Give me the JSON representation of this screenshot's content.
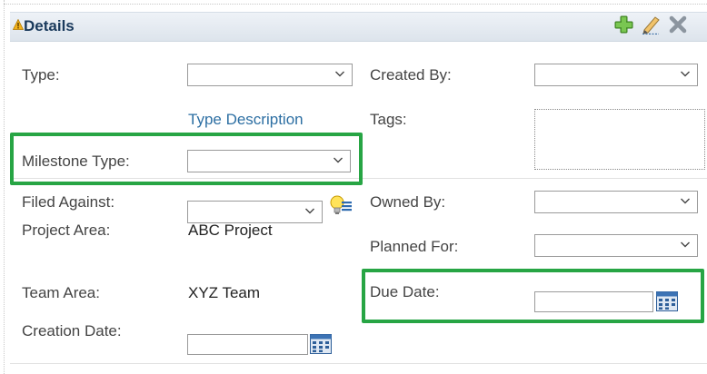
{
  "panel": {
    "title": "Details",
    "actions": {
      "add": "plus-icon",
      "edit": "pencil-icon",
      "close": "x-icon"
    }
  },
  "left_fields": {
    "type_label": "Type:",
    "type_description_link": "Type Description",
    "milestone_type_label": "Milestone Type:",
    "filed_against_label": "Filed Against:",
    "project_area_label": "Project Area:",
    "project_area_value": "ABC Project",
    "team_area_label": "Team Area:",
    "team_area_value": "XYZ Team",
    "creation_date_label": "Creation Date:"
  },
  "right_fields": {
    "created_by_label": "Created By:",
    "tags_label": "Tags:",
    "owned_by_label": "Owned By:",
    "planned_for_label": "Planned For:",
    "due_date_label": "Due Date:"
  },
  "colors": {
    "highlight": "#27a544",
    "link": "#2d6fa3",
    "header_text": "#1a3a5c"
  }
}
